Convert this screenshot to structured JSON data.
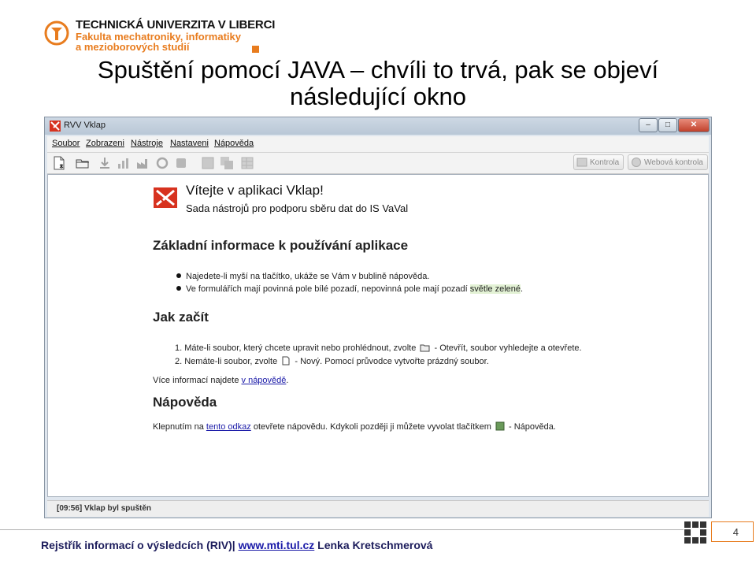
{
  "slide": {
    "university": {
      "line1": "TECHNICKÁ UNIVERZITA V LIBERCI",
      "line2": "Fakulta mechatroniky, informatiky",
      "line3": "a mezioborových studií"
    },
    "title_line1": "Spuštění pomocí JAVA – chvíli to trvá, pak se objeví",
    "title_line2": "následující okno",
    "footer": {
      "text": "Rejstřík informací o výsledcích (RIV)|",
      "link": "www.mti.tul.cz",
      "author": "Lenka Kretschmerová"
    },
    "page_number": "4",
    "accent_color": "#e87c1e"
  },
  "window": {
    "title": "RVV Vklap",
    "menu": [
      "Soubor",
      "Zobrazeni",
      "Nástroje",
      "Nastaveni",
      "Nápověda"
    ],
    "toolbar": {
      "check_label": "Kontrola",
      "web_check_label": "Webová kontrola"
    },
    "status": "[09:56] Vklap byl spuštěn"
  },
  "content": {
    "welcome_title": "Vítejte v aplikaci Vklap!",
    "welcome_subtitle": "Sada nástrojů pro podporu sběru dat do IS VaVal",
    "basic_heading": "Základní informace k používání aplikace",
    "bullet1": "Najedete-li myší na tlačítko, ukáže se Vám v bublině nápověda.",
    "bullet2_pre": "Ve formulářích mají povinná pole bílé pozadí, nepovinná pole mají pozadí",
    "bullet2_hl": "světle zelené",
    "bullet2_post": ".",
    "start_heading": "Jak začít",
    "step1_pre": "1. Máte-li soubor, který chcete upravit nebo prohlédnout, zvolte",
    "step1_post": "- Otevřít, soubor vyhledejte a otevřete.",
    "step2_pre": "2. Nemáte-li soubor, zvolte",
    "step2_post": "- Nový. Pomocí průvodce vytvořte prázdný soubor.",
    "more_pre": "Více informací najdete",
    "more_link": "v nápovědě",
    "more_post": ".",
    "help_heading": "Nápověda",
    "help_pre": "Klepnutím na",
    "help_link": "tento odkaz",
    "help_mid": "otevřete nápovědu. Kdykoli později ji můžete vyvolat tlačítkem",
    "help_post": "- Nápověda."
  }
}
